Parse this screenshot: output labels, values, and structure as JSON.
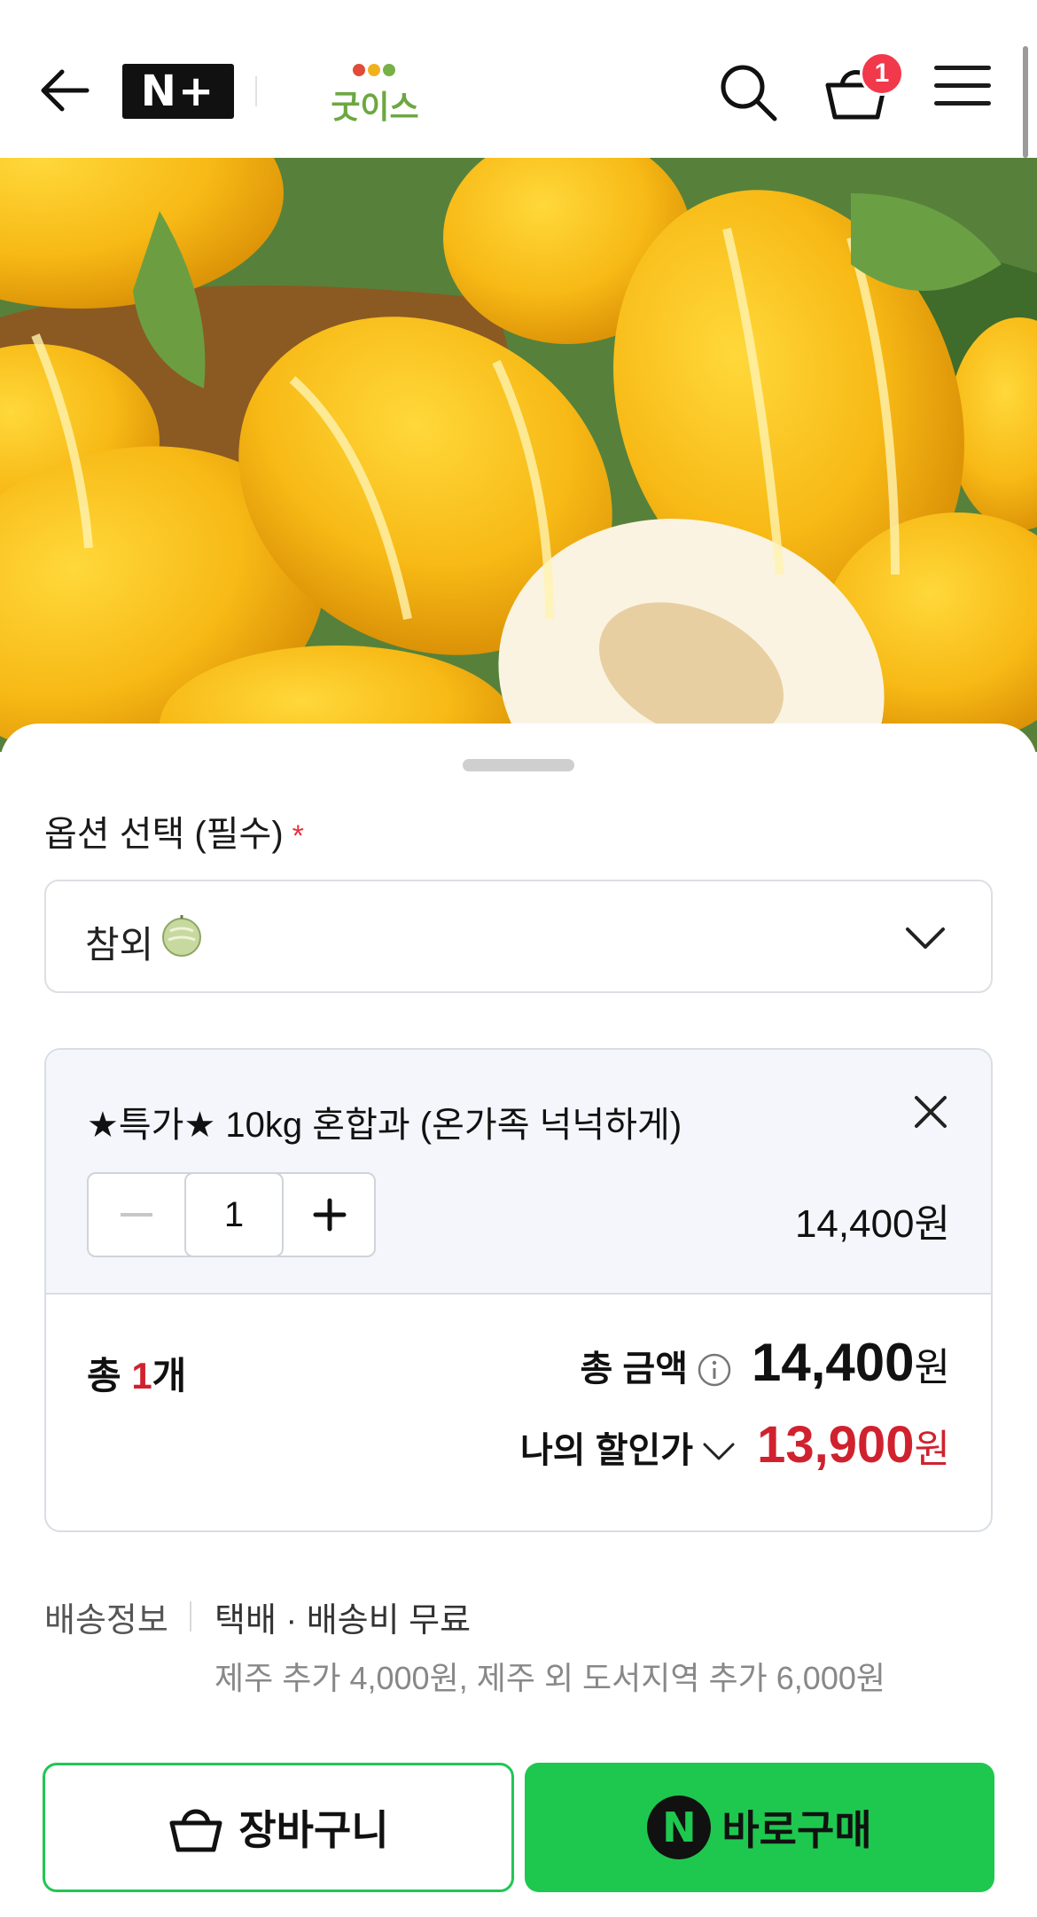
{
  "header": {
    "back_icon": "arrow-left-icon",
    "nplus_label": "N+",
    "brand_name": "굿이스",
    "cart_count": "1",
    "colors": {
      "badge": "#f2384b",
      "brand": "#6da741"
    }
  },
  "hero": {
    "alt": "참외"
  },
  "option": {
    "label": "옵션 선택 (필수)",
    "required_mark": "*",
    "selected": "참외"
  },
  "item": {
    "name": "★특가★ 10kg 혼합과 (온가족 넉넉하게)",
    "quantity": "1",
    "price": "14,400원"
  },
  "summary": {
    "total_prefix": "총 ",
    "total_count": "1",
    "total_suffix": "개",
    "total_label": "총 금액",
    "total_amount": "14,400",
    "currency": "원",
    "discount_label": "나의 할인가",
    "discount_amount": "13,900"
  },
  "shipping": {
    "label": "배송정보",
    "info": "택배 · 배송비 무료",
    "extra": "제주 추가 4,000원, 제주 외 도서지역 추가 6,000원"
  },
  "actions": {
    "cart_label": "장바구니",
    "buy_label": "바로구매",
    "buy_badge": "N",
    "colors": {
      "primary": "#1ec84f",
      "discount": "#d0222e"
    }
  }
}
